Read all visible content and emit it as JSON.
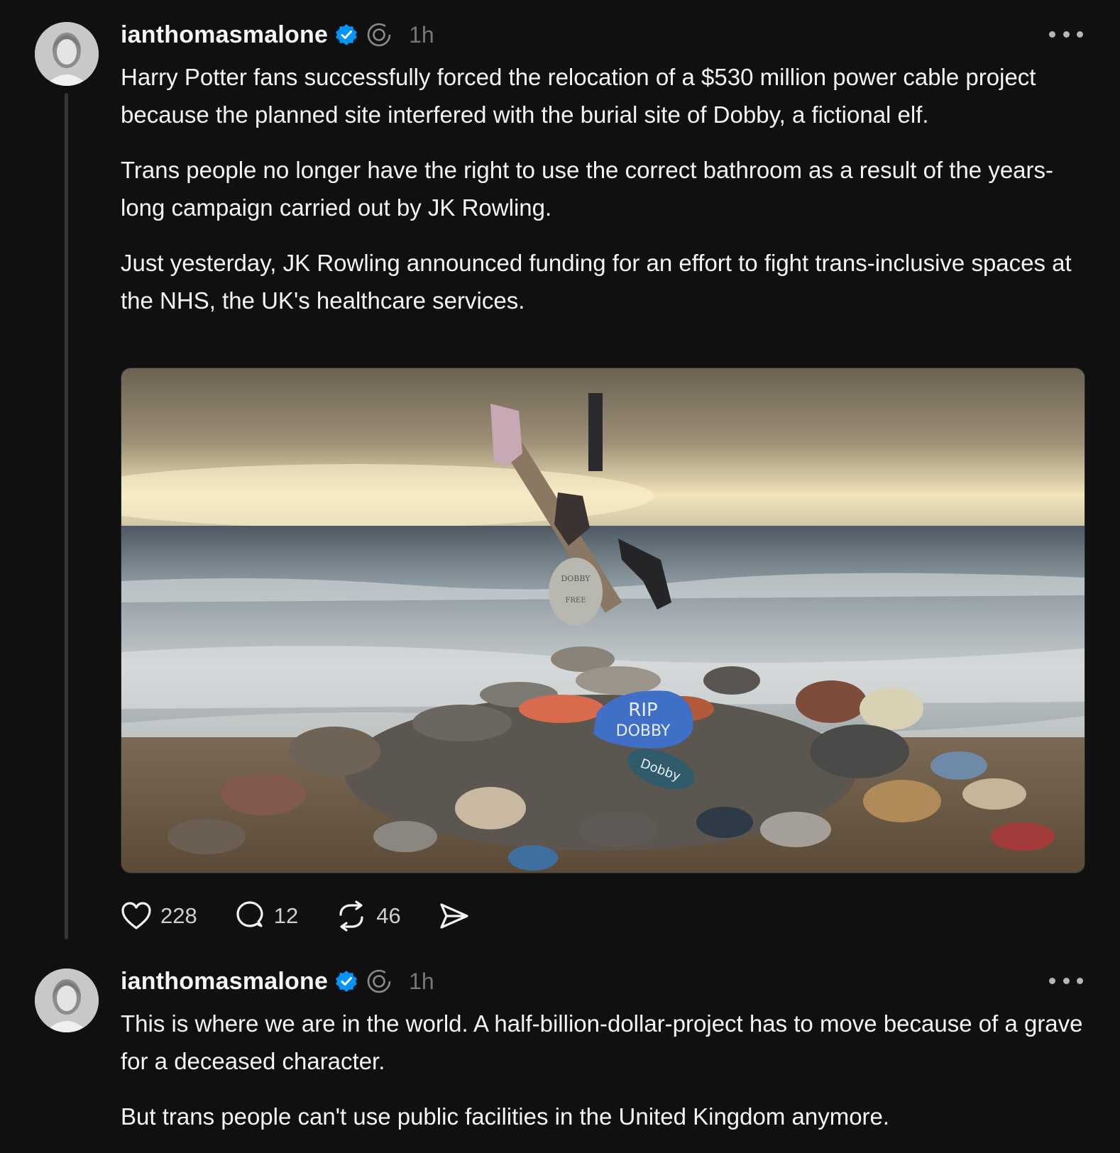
{
  "posts": [
    {
      "username": "ianthomasmalone",
      "time": "1h",
      "paragraphs": [
        "Harry Potter fans successfully forced the relocation of a $530 million power cable project because the planned site interfered with the burial site of Dobby, a fictional elf.",
        "Trans people no longer have the right to use the correct bathroom as a result of the years-long campaign carried out by JK Rowling.",
        "Just yesterday, JK Rowling announced funding for an effort to fight trans-inclusive spaces at the NHS, the UK's healthcare services."
      ],
      "image": {
        "stone_1": "RIP",
        "stone_2": "DOBBY",
        "stone_3": "Dobby",
        "stone_4": "DOBBY",
        "stone_5": "FREE"
      },
      "actions": {
        "likes": "228",
        "replies": "12",
        "reposts": "46"
      }
    },
    {
      "username": "ianthomasmalone",
      "time": "1h",
      "paragraphs": [
        "This is where we are in the world. A half-billion-dollar-project has to move because of a grave for a deceased character.",
        "But trans people can't use public facilities in the United Kingdom anymore."
      ]
    }
  ],
  "icons": {
    "verified": "verified-badge-icon",
    "spiral": "threads-spiral-icon",
    "more": "more-options-icon",
    "like": "heart-icon",
    "reply": "comment-bubble-icon",
    "repost": "repost-icon",
    "share": "send-icon"
  },
  "colors": {
    "background": "#101010",
    "text": "#f3f5f7",
    "muted": "#777777",
    "verified": "#0095f6",
    "thread_line": "#333638"
  }
}
